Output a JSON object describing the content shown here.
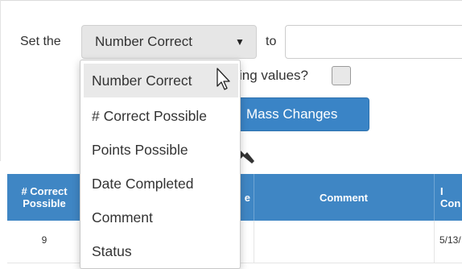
{
  "form": {
    "set_label": "Set the",
    "selected_field": "Number Correct",
    "to_label": "to",
    "to_value": "",
    "question_fragment": "ing values?",
    "checkbox_checked": false,
    "mass_button_label": "Mass Changes"
  },
  "dropdown": {
    "options": [
      {
        "label": "Number Correct",
        "highlighted": true
      },
      {
        "label": "# Correct Possible",
        "highlighted": false
      },
      {
        "label": "Points Possible",
        "highlighted": false
      },
      {
        "label": "Date Completed",
        "highlighted": false
      },
      {
        "label": "Comment",
        "highlighted": false
      },
      {
        "label": "Status",
        "highlighted": false
      }
    ]
  },
  "table": {
    "header_color": "#3f86c4",
    "headers": {
      "correct_possible": "# Correct Possible",
      "col2_fragment": "e",
      "comment": "Comment",
      "col4_fragment_top": "I",
      "col4_fragment_bottom": "Con"
    },
    "rows": [
      {
        "correct_possible": "9",
        "date_fragment": "5/13/"
      }
    ]
  },
  "icons": {
    "caret": "caret-down-icon",
    "wrench": "wrench-icon",
    "pointer": "mouse-pointer-icon"
  },
  "colors": {
    "primary_button": "#3a84c6",
    "select_bg": "#e6e6e6",
    "highlight_option": "#e9e9e9"
  }
}
